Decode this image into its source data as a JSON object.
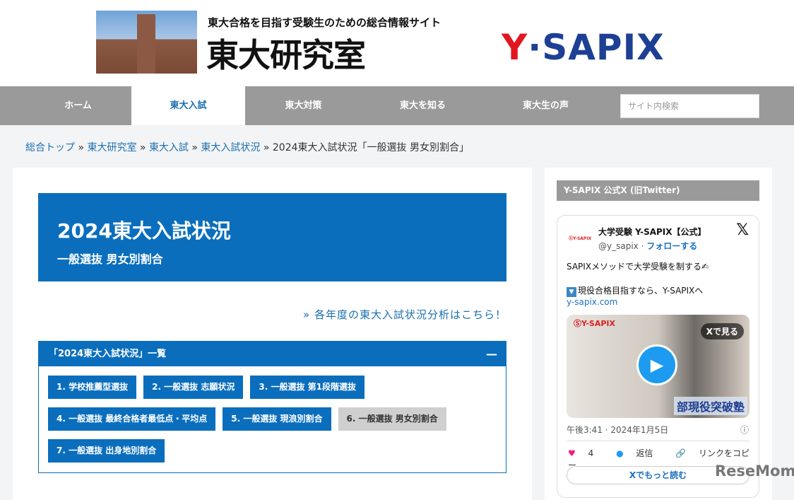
{
  "header": {
    "tagline": "東大合格を目指す受験生のための総合情報サイト",
    "site_name": "東大研究室",
    "brand_y": "Y",
    "brand_rest": "·SAPIX"
  },
  "nav": {
    "items": [
      "ホーム",
      "東大入試",
      "東大対策",
      "東大を知る",
      "東大生の声"
    ],
    "active": 1,
    "search_placeholder": "サイト内検索"
  },
  "breadcrumb": {
    "links": [
      "総合トップ",
      "東大研究室",
      "東大入試",
      "東大入試状況"
    ],
    "sep": " » ",
    "current": "2024東大入試状況「一般選抜 男女別割合」"
  },
  "main": {
    "title": "2024東大入試状況",
    "subtitle": "一般選抜 男女別割合",
    "more_link": "» 各年度の東大入試状況分析はこちら！",
    "accordion": {
      "title": "「2024東大入試状況」一覧",
      "toggle": "—",
      "buttons": [
        "1. 学校推薦型選抜",
        "2. 一般選抜 志願状況",
        "3. 一般選抜 第1段階選抜",
        "4. 一般選抜 最終合格者最低点・平均点",
        "5. 一般選抜 現浪別割合",
        "6. 一般選抜 男女別割合",
        "7. 一般選抜 出身地別割合"
      ]
    }
  },
  "sidebar": {
    "heading": "Y-SAPIX 公式X (旧Twitter)",
    "tweet": {
      "logo": "ⓈY-SAPIX",
      "name": "大学受験 Y-SAPIX【公式】",
      "handle": "@y_sapix · ",
      "follow": "フォローする",
      "x_icon": "𝕏",
      "text1": "SAPIXメソッドで大学受験を制する✍",
      "text2": "現役合格目指すなら、Y-SAPIXへ",
      "link": "y-sapix.com",
      "media_logo": "ⓈY-SAPIX",
      "watch": "Xで見る",
      "caption": "部現役突破塾",
      "time": "午後3:41 · 2024年1月5日",
      "likes": "4",
      "reply": "返信",
      "copy": "リンクをコピー",
      "read_more": "Xでもっと読む"
    }
  },
  "watermark": "ReseMom"
}
